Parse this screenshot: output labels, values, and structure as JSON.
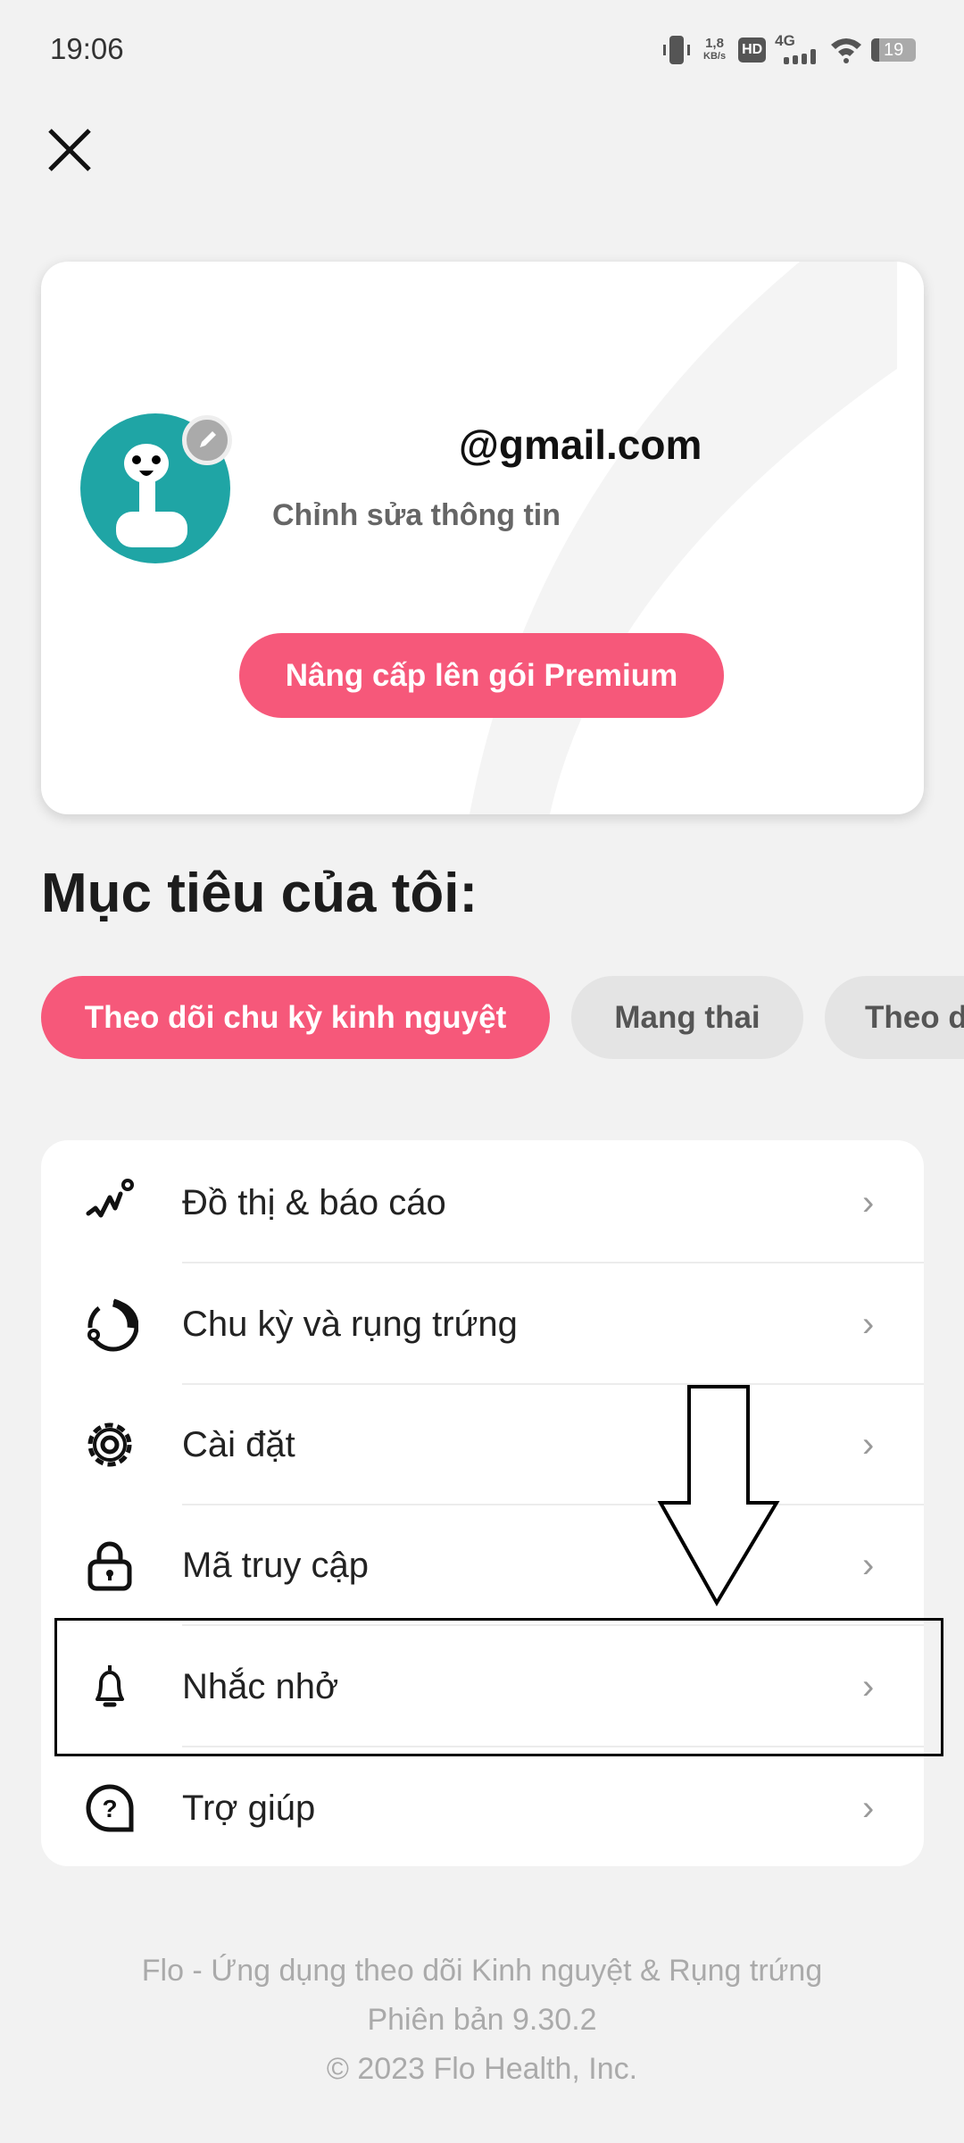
{
  "status_bar": {
    "time": "19:06",
    "net_speed_value": "1,8",
    "net_speed_unit": "KB/s",
    "hd": "HD",
    "network": "4G",
    "battery": "19"
  },
  "profile": {
    "email": "@gmail.com",
    "edit_info": "Chỉnh sửa thông tin",
    "premium_button": "Nâng cấp lên gói Premium",
    "avatar_color": "#1fa5a5"
  },
  "goals": {
    "title": "Mục tiêu của tôi:",
    "chips": [
      {
        "label": "Theo dõi chu kỳ kinh nguyệt",
        "selected": true
      },
      {
        "label": "Mang thai",
        "selected": false
      },
      {
        "label": "Theo dõi thai kỳ",
        "selected": false
      }
    ]
  },
  "menu": [
    {
      "label": "Đồ thị & báo cáo",
      "icon": "chart-icon"
    },
    {
      "label": "Chu kỳ và rụng trứng",
      "icon": "cycle-icon"
    },
    {
      "label": "Cài đặt",
      "icon": "gear-icon"
    },
    {
      "label": "Mã truy cập",
      "icon": "lock-icon"
    },
    {
      "label": "Nhắc nhở",
      "icon": "bell-icon",
      "highlighted": true
    },
    {
      "label": "Trợ giúp",
      "icon": "help-icon"
    }
  ],
  "footer": {
    "line1": "Flo - Ứng dụng theo dõi Kinh nguyệt & Rụng trứng",
    "line2": "Phiên bản 9.30.2",
    "line3": "© 2023 Flo Health, Inc."
  },
  "colors": {
    "accent": "#f6587a",
    "chip_inactive": "#e4e4e4"
  }
}
